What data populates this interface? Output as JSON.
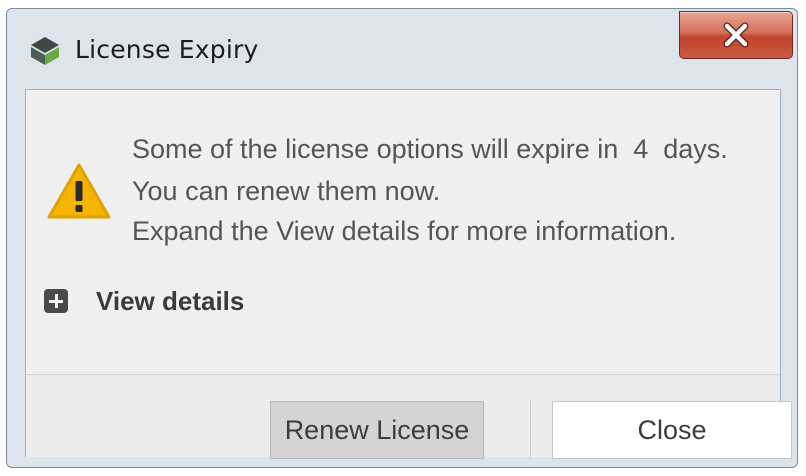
{
  "window": {
    "title": "License Expiry",
    "app_icon": "cube-logo-icon",
    "close_icon": "close-icon"
  },
  "message": {
    "icon": "warning-icon",
    "line1": "Some of the license options will expire in  4  days.",
    "line2": "You can renew them now.",
    "line3": "Expand the View details for more information."
  },
  "details": {
    "icon": "plus-expand-icon",
    "label": "View details"
  },
  "buttons": {
    "renew_label": "Renew License",
    "close_label": "Close"
  },
  "colors": {
    "warning": "#f4b400",
    "close_button": "#c9452f",
    "logo_dark": "#3c4a45",
    "logo_green": "#6aaa44"
  }
}
